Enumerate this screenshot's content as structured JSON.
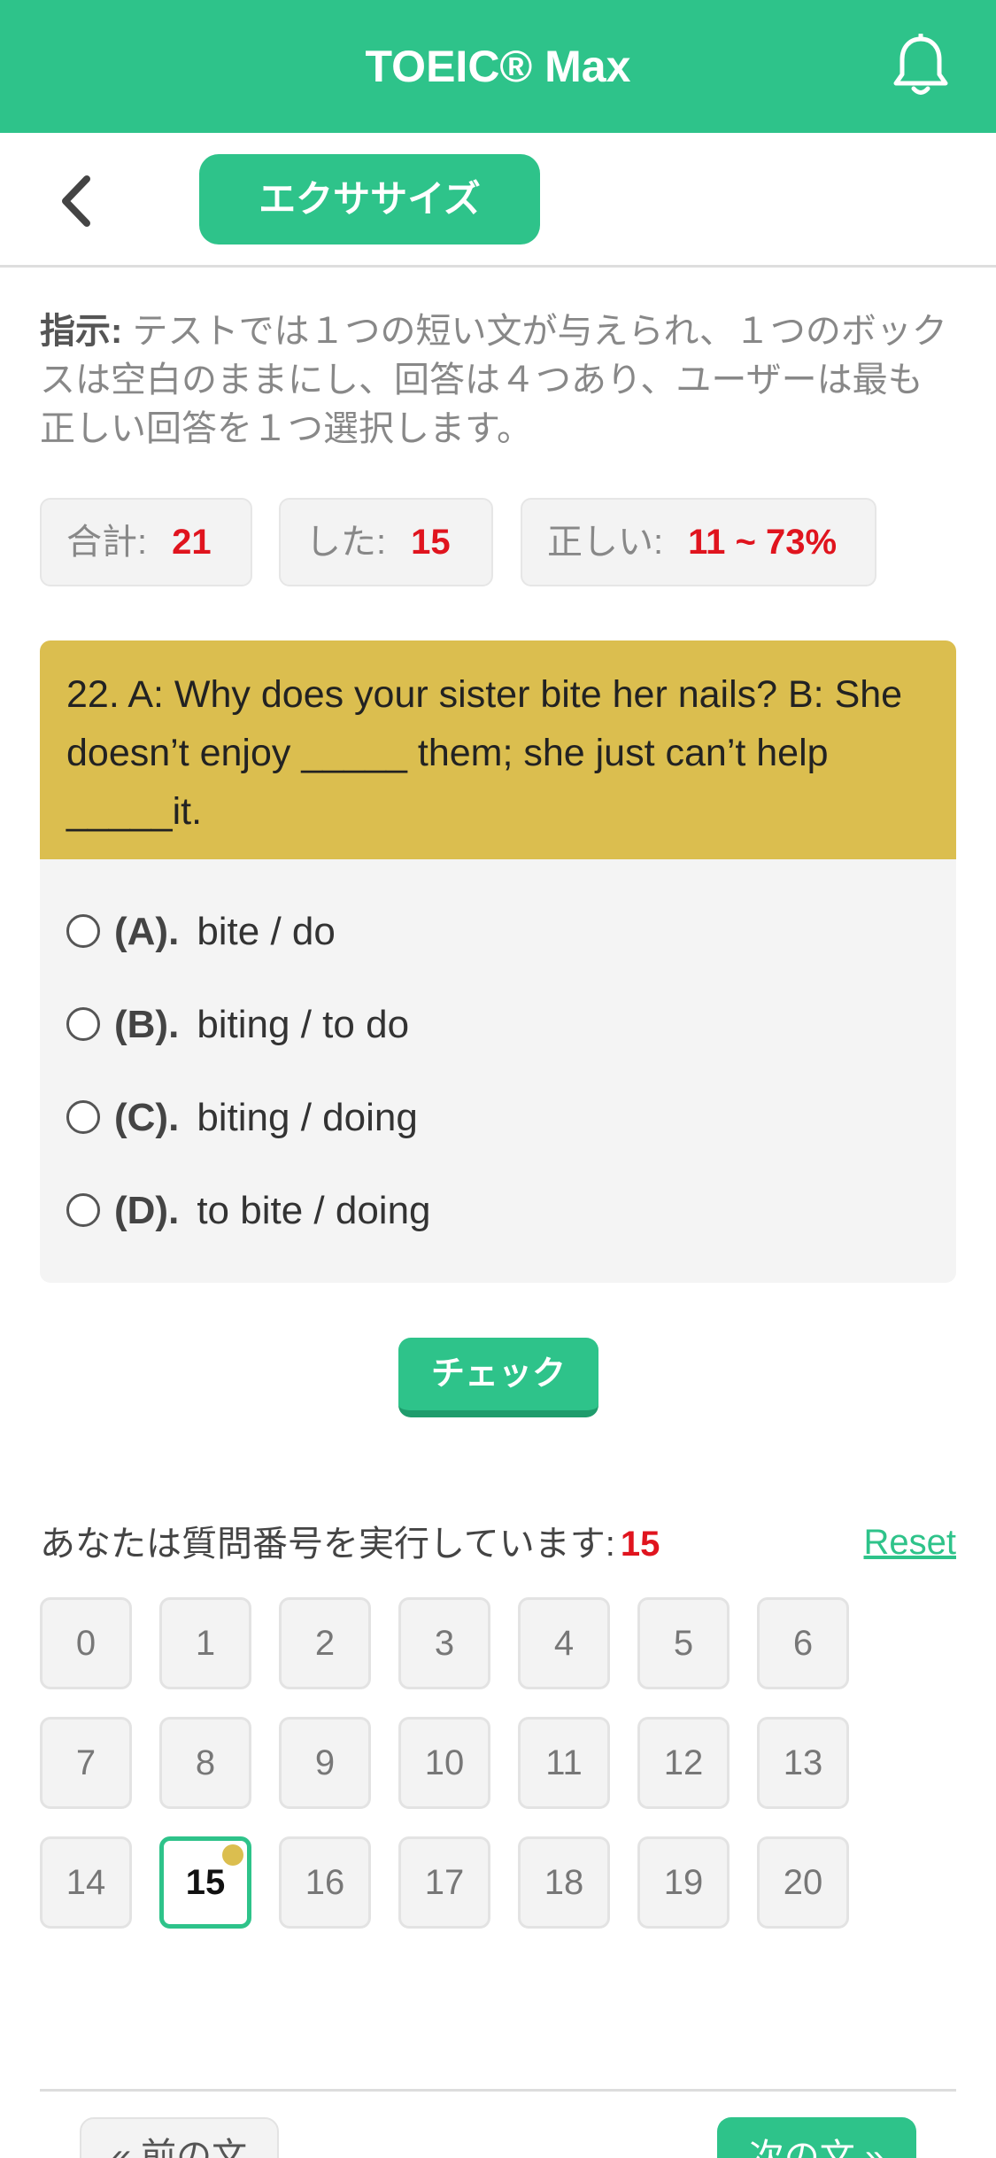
{
  "header": {
    "title": "TOEIC® Max",
    "bell_icon": "bell-icon",
    "color": "#2ec38a"
  },
  "nav": {
    "back_icon": "chevron-left-icon",
    "tab_label": "エクササイズ"
  },
  "instructions": {
    "label": "指示:",
    "text": " テストでは１つの短い文が与えられ、１つのボックスは空白のままにし、回答は４つあり、ユーザーは最も正しい回答を１つ選択します。"
  },
  "stats": [
    {
      "label": "合計:",
      "value": "21"
    },
    {
      "label": "した:",
      "value": "15"
    },
    {
      "label": "正しい:",
      "value": "11 ~ 73%"
    }
  ],
  "question": {
    "text": "22. A: Why does your sister bite her nails? B: She doesn’t enjoy _____ them; she just can’t help _____it.",
    "header_color": "#dbbe4f",
    "options": [
      {
        "letter": "(A).",
        "text": "bite / do"
      },
      {
        "letter": "(B).",
        "text": "biting / to do"
      },
      {
        "letter": "(C).",
        "text": "biting / doing"
      },
      {
        "letter": "(D).",
        "text": "to bite / doing"
      }
    ]
  },
  "check_label": "チェック",
  "progress": {
    "text": "あなたは質問番号を実行しています:",
    "current": "15",
    "reset_label": "Reset",
    "numbers": [
      "0",
      "1",
      "2",
      "3",
      "4",
      "5",
      "6",
      "7",
      "8",
      "9",
      "10",
      "11",
      "12",
      "13",
      "14",
      "15",
      "16",
      "17",
      "18",
      "19",
      "20"
    ],
    "active_index": 15
  },
  "pager": {
    "prev_label": "« 前の文",
    "next_label": "次の文 »"
  }
}
